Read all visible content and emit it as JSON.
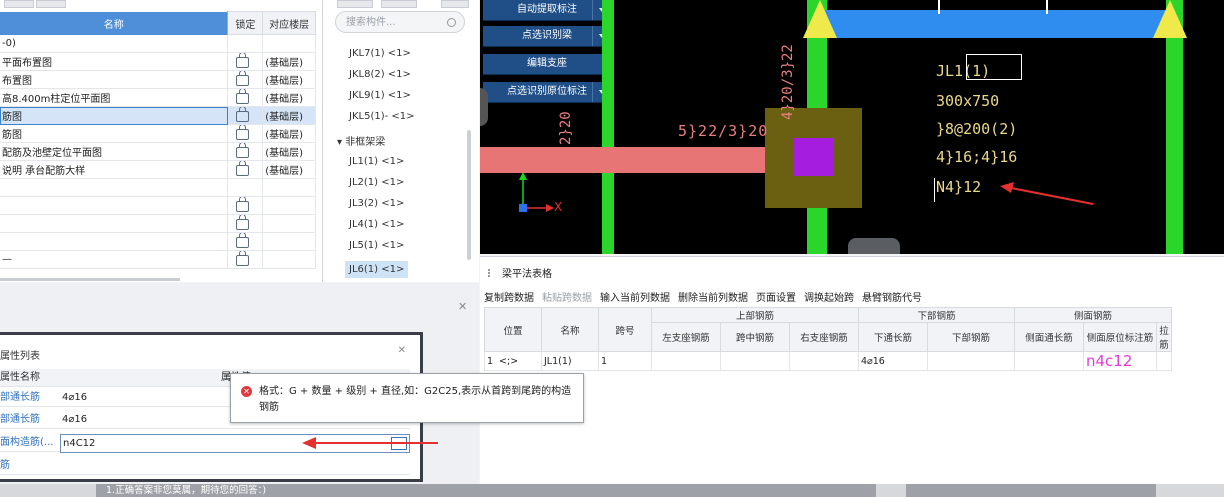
{
  "drawings": {
    "headers": {
      "name": "名称",
      "lock": "锁定",
      "floor": "对应楼层"
    },
    "rows": [
      {
        "name": "-0)",
        "floor": ""
      },
      {
        "name": "平面布置图",
        "floor": "(基础层)"
      },
      {
        "name": "布置图",
        "floor": "(基础层)"
      },
      {
        "name": "高8.400m柱定位平面图",
        "floor": "(基础层)"
      },
      {
        "name": "筋图",
        "floor": "(基础层)"
      },
      {
        "name": "筋图",
        "floor": "(基础层)"
      },
      {
        "name": "配筋及池壁定位平面图",
        "floor": "(基础层)"
      },
      {
        "name": "说明 承台配筋大样",
        "floor": "(基础层)"
      },
      {
        "name": "",
        "floor": ""
      },
      {
        "name": "",
        "floor": ""
      },
      {
        "name": "",
        "floor": ""
      },
      {
        "name": "",
        "floor": ""
      },
      {
        "name": "—",
        "floor": ""
      }
    ]
  },
  "components": {
    "search_placeholder": "搜索构件...",
    "items": [
      "JKL7(1) <1>",
      "JKL8(2) <1>",
      "JKL9(1) <1>",
      "JKL5(1)- <1>"
    ],
    "group": "▾ 非框架梁",
    "group_items": [
      "JL1(1) <1>",
      "JL2(1) <1>",
      "JL3(2) <1>",
      "JL4(1) <1>",
      "JL5(1) <1>",
      "JL6(1) <1>"
    ]
  },
  "cad": {
    "tools": [
      "自动提取标注",
      "点选识别梁",
      "编辑支座",
      "点选识别原位标注"
    ],
    "labels": {
      "l1": "JL1(1)",
      "l2": "300x750",
      "l3": "}8@200(2)",
      "l4": "4}16;4}16",
      "l5": "N4}12",
      "v1": "4}20/3}22",
      "v2": "2}20",
      "h1": "5}22/3}20",
      "x": "X"
    }
  },
  "beam_table": {
    "title": "梁平法表格",
    "toolbar": [
      "复制跨数据",
      "粘贴跨数据",
      "输入当前列数据",
      "删除当前列数据",
      "页面设置",
      "调换起始跨",
      "悬臂钢筋代号"
    ],
    "group_headers": {
      "top": "上部钢筋",
      "bottom": "下部钢筋",
      "side": "侧面钢筋"
    },
    "headers": {
      "pos": "位置",
      "name": "名称",
      "span": "跨号",
      "left": "左支座钢筋",
      "mid": "跨中钢筋",
      "right": "右支座钢筋",
      "btm_through": "下通长筋",
      "btm": "下部钢筋",
      "side_through": "侧面通长筋",
      "side_orig": "侧面原位标注筋",
      "tie": "拉筋"
    },
    "row": {
      "idx": "1",
      "pos": "<;>",
      "name": "JL1(1)",
      "span": "1",
      "btm_through": "4⌀16",
      "side_orig": "n4c12"
    }
  },
  "properties": {
    "title": "属性列表",
    "header_name": "属性名称",
    "header_value": "属性值",
    "rows": [
      {
        "k": "部通长筋",
        "v": "4⌀16"
      },
      {
        "k": "部通长筋",
        "v": "4⌀16"
      },
      {
        "k": "面构造筋(...",
        "v": "n4C12"
      },
      {
        "k": "筋",
        "v": ""
      }
    ],
    "tooltip": "格式：G + 数量 + 级别 + 直径,如：G2C25,表示从首跨到尾跨的构造钢筋",
    "dots": "..."
  },
  "footer": {
    "answer": "1.正确答案非您莫属，期待您的回答：)"
  }
}
